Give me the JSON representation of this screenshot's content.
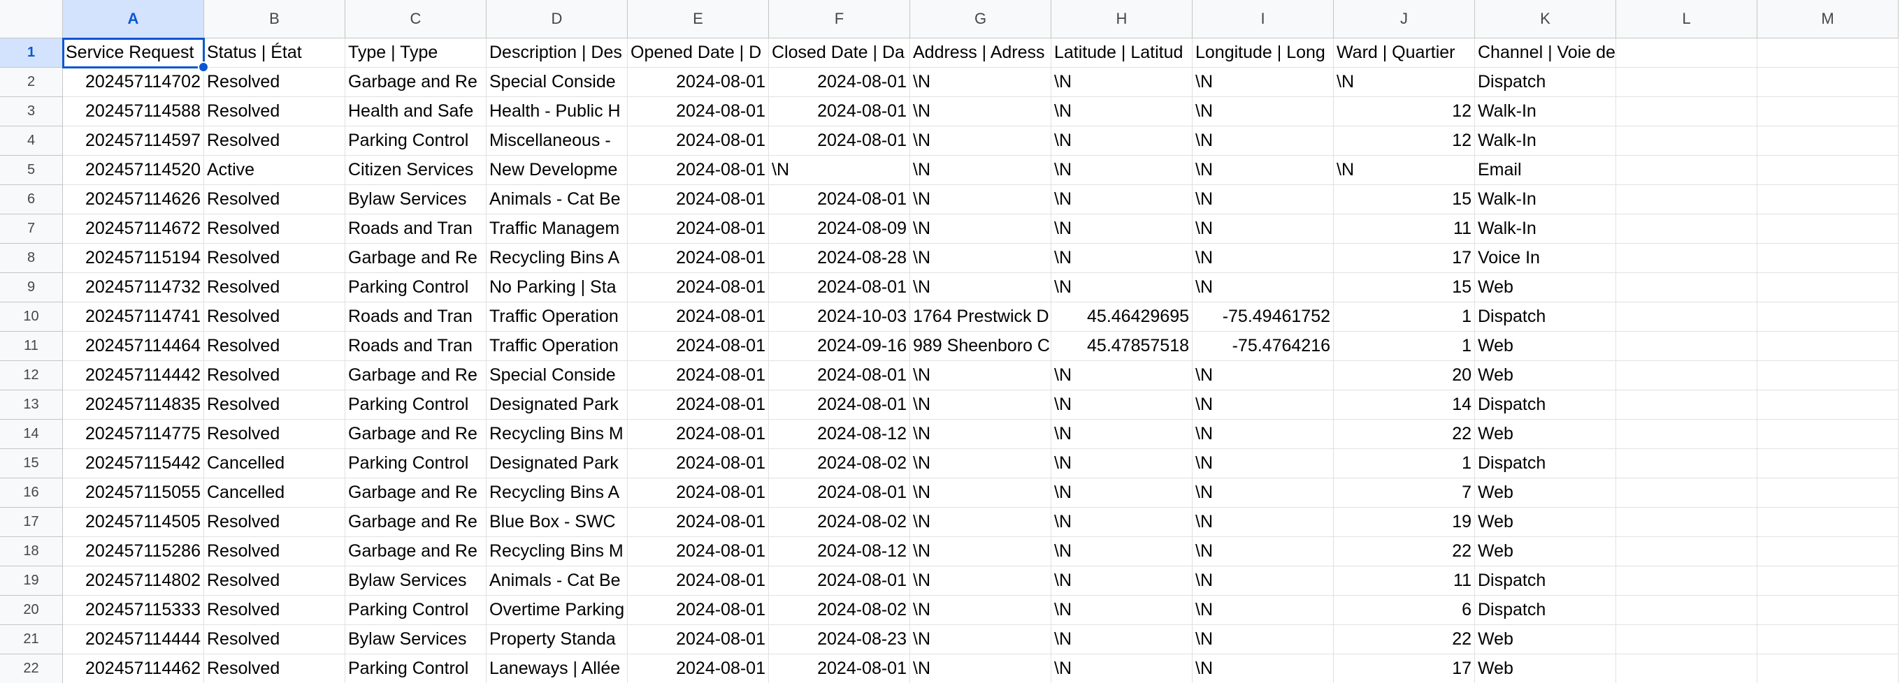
{
  "columns": [
    "A",
    "B",
    "C",
    "D",
    "E",
    "F",
    "G",
    "H",
    "I",
    "J",
    "K",
    "L",
    "M"
  ],
  "row_numbers": [
    "1",
    "2",
    "3",
    "4",
    "5",
    "6",
    "7",
    "8",
    "9",
    "10",
    "11",
    "12",
    "13",
    "14",
    "15",
    "16",
    "17",
    "18",
    "19",
    "20",
    "21",
    "22"
  ],
  "active_cell": "A1",
  "rows": [
    [
      "Service Request",
      "Status | État",
      "Type | Type",
      "Description | Des",
      "Opened Date | D",
      "Closed Date | Da",
      "Address | Adress",
      "Latitude | Latitud",
      "Longitude | Long",
      "Ward | Quartier",
      "Channel | Voie de service",
      "",
      ""
    ],
    [
      "202457114702",
      "Resolved",
      "Garbage and Re",
      "Special Conside",
      "2024-08-01",
      "2024-08-01",
      "\\N",
      "\\N",
      "\\N",
      "\\N",
      "Dispatch",
      "",
      ""
    ],
    [
      "202457114588",
      "Resolved",
      "Health and Safe",
      "Health - Public H",
      "2024-08-01",
      "2024-08-01",
      "\\N",
      "\\N",
      "\\N",
      "12",
      "Walk-In",
      "",
      ""
    ],
    [
      "202457114597",
      "Resolved",
      "Parking Control",
      "Miscellaneous -",
      "2024-08-01",
      "2024-08-01",
      "\\N",
      "\\N",
      "\\N",
      "12",
      "Walk-In",
      "",
      ""
    ],
    [
      "202457114520",
      "Active",
      "Citizen Services",
      "New Developme",
      "2024-08-01",
      "\\N",
      "\\N",
      "\\N",
      "\\N",
      "\\N",
      "Email",
      "",
      ""
    ],
    [
      "202457114626",
      "Resolved",
      "Bylaw Services",
      "Animals - Cat Be",
      "2024-08-01",
      "2024-08-01",
      "\\N",
      "\\N",
      "\\N",
      "15",
      "Walk-In",
      "",
      ""
    ],
    [
      "202457114672",
      "Resolved",
      "Roads and Tran",
      "Traffic Managem",
      "2024-08-01",
      "2024-08-09",
      "\\N",
      "\\N",
      "\\N",
      "11",
      "Walk-In",
      "",
      ""
    ],
    [
      "202457115194",
      "Resolved",
      "Garbage and Re",
      "Recycling Bins A",
      "2024-08-01",
      "2024-08-28",
      "\\N",
      "\\N",
      "\\N",
      "17",
      "Voice In",
      "",
      ""
    ],
    [
      "202457114732",
      "Resolved",
      "Parking Control",
      "No Parking | Sta",
      "2024-08-01",
      "2024-08-01",
      "\\N",
      "\\N",
      "\\N",
      "15",
      "Web",
      "",
      ""
    ],
    [
      "202457114741",
      "Resolved",
      "Roads and Tran",
      "Traffic Operation",
      "2024-08-01",
      "2024-10-03",
      "1764 Prestwick D",
      "45.46429695",
      "-75.49461752",
      "1",
      "Dispatch",
      "",
      ""
    ],
    [
      "202457114464",
      "Resolved",
      "Roads and Tran",
      "Traffic Operation",
      "2024-08-01",
      "2024-09-16",
      "989 Sheenboro C",
      "45.47857518",
      "-75.4764216",
      "1",
      "Web",
      "",
      ""
    ],
    [
      "202457114442",
      "Resolved",
      "Garbage and Re",
      "Special Conside",
      "2024-08-01",
      "2024-08-01",
      "\\N",
      "\\N",
      "\\N",
      "20",
      "Web",
      "",
      ""
    ],
    [
      "202457114835",
      "Resolved",
      "Parking Control",
      "Designated Park",
      "2024-08-01",
      "2024-08-01",
      "\\N",
      "\\N",
      "\\N",
      "14",
      "Dispatch",
      "",
      ""
    ],
    [
      "202457114775",
      "Resolved",
      "Garbage and Re",
      "Recycling Bins M",
      "2024-08-01",
      "2024-08-12",
      "\\N",
      "\\N",
      "\\N",
      "22",
      "Web",
      "",
      ""
    ],
    [
      "202457115442",
      "Cancelled",
      "Parking Control",
      "Designated Park",
      "2024-08-01",
      "2024-08-02",
      "\\N",
      "\\N",
      "\\N",
      "1",
      "Dispatch",
      "",
      ""
    ],
    [
      "202457115055",
      "Cancelled",
      "Garbage and Re",
      "Recycling Bins A",
      "2024-08-01",
      "2024-08-01",
      "\\N",
      "\\N",
      "\\N",
      "7",
      "Web",
      "",
      ""
    ],
    [
      "202457114505",
      "Resolved",
      "Garbage and Re",
      "Blue Box - SWC",
      "2024-08-01",
      "2024-08-02",
      "\\N",
      "\\N",
      "\\N",
      "19",
      "Web",
      "",
      ""
    ],
    [
      "202457115286",
      "Resolved",
      "Garbage and Re",
      "Recycling Bins M",
      "2024-08-01",
      "2024-08-12",
      "\\N",
      "\\N",
      "\\N",
      "22",
      "Web",
      "",
      ""
    ],
    [
      "202457114802",
      "Resolved",
      "Bylaw Services",
      "Animals - Cat Be",
      "2024-08-01",
      "2024-08-01",
      "\\N",
      "\\N",
      "\\N",
      "11",
      "Dispatch",
      "",
      ""
    ],
    [
      "202457115333",
      "Resolved",
      "Parking Control",
      "Overtime Parking",
      "2024-08-01",
      "2024-08-02",
      "\\N",
      "\\N",
      "\\N",
      "6",
      "Dispatch",
      "",
      ""
    ],
    [
      "202457114444",
      "Resolved",
      "Bylaw Services",
      "Property Standa",
      "2024-08-01",
      "2024-08-23",
      "\\N",
      "\\N",
      "\\N",
      "22",
      "Web",
      "",
      ""
    ],
    [
      "202457114462",
      "Resolved",
      "Parking Control",
      "Laneways | Allée",
      "2024-08-01",
      "2024-08-01",
      "\\N",
      "\\N",
      "\\N",
      "17",
      "Web",
      "",
      ""
    ]
  ]
}
